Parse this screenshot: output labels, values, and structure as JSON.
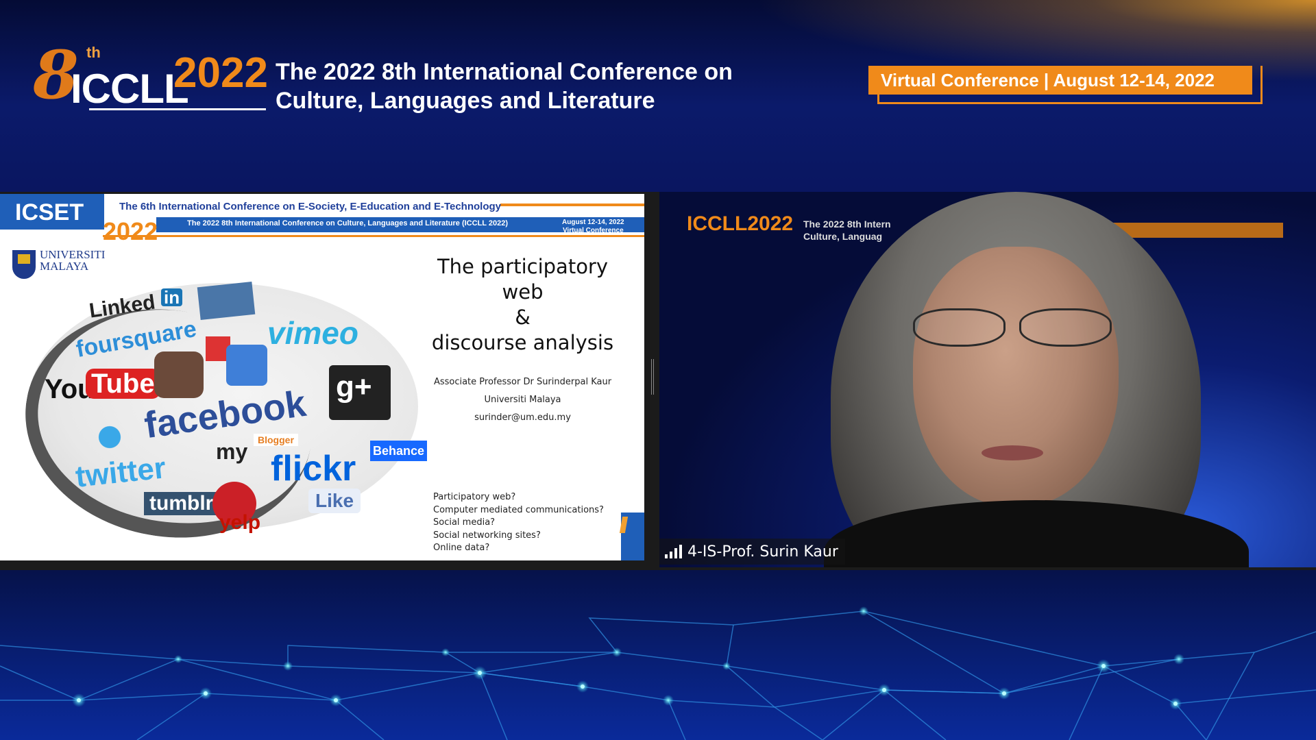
{
  "header": {
    "logo_ordinal": "8",
    "logo_suffix": "th",
    "logo_name": "ICCLL",
    "logo_year": "2022",
    "title": "The 2022 8th International Conference on Culture, Languages and Literature",
    "badge": "Virtual Conference | August 12-14, 2022"
  },
  "slide": {
    "acronym": "ICSET",
    "year": "2022",
    "line1": "The 6th International Conference on E-Society, E-Education and E-Technology",
    "line2": "The 2022 8th International Conference on Culture, Languages and Literature (ICCLL 2022)",
    "date": "August 12-14, 2022",
    "date_sub": "Virtual Conference",
    "university_line1": "UNIVERSITI",
    "university_line2": "MALAYA",
    "title_lines": [
      "The participatory",
      "web",
      "&",
      "discourse analysis"
    ],
    "author": "Associate Professor Dr Surinderpal Kaur",
    "affiliation": "Universiti Malaya",
    "email": "surinder@um.edu.my",
    "questions": [
      "Participatory web?",
      "Computer mediated communications?",
      "Social media?",
      "Social networking sites?",
      "Online data?"
    ],
    "collage_words": [
      "Linked",
      "in",
      "foursquare",
      "You",
      "Tube",
      "facebook",
      "g+",
      "vimeo",
      "twitter",
      "my",
      "Blogger",
      "flickr",
      "Behance",
      "tumblr.",
      "yelp",
      "Like"
    ]
  },
  "video": {
    "overlay_logo": "ICCLL",
    "overlay_year": "2022",
    "overlay_title_1": "The 2022 8th Intern",
    "overlay_title_2": "Culture, Languag",
    "participant_name": "4-IS-Prof. Surin Kaur"
  },
  "colors": {
    "accent_orange": "#f08a1a",
    "brand_blue": "#1f5fb8",
    "background_navy": "#050a30"
  }
}
